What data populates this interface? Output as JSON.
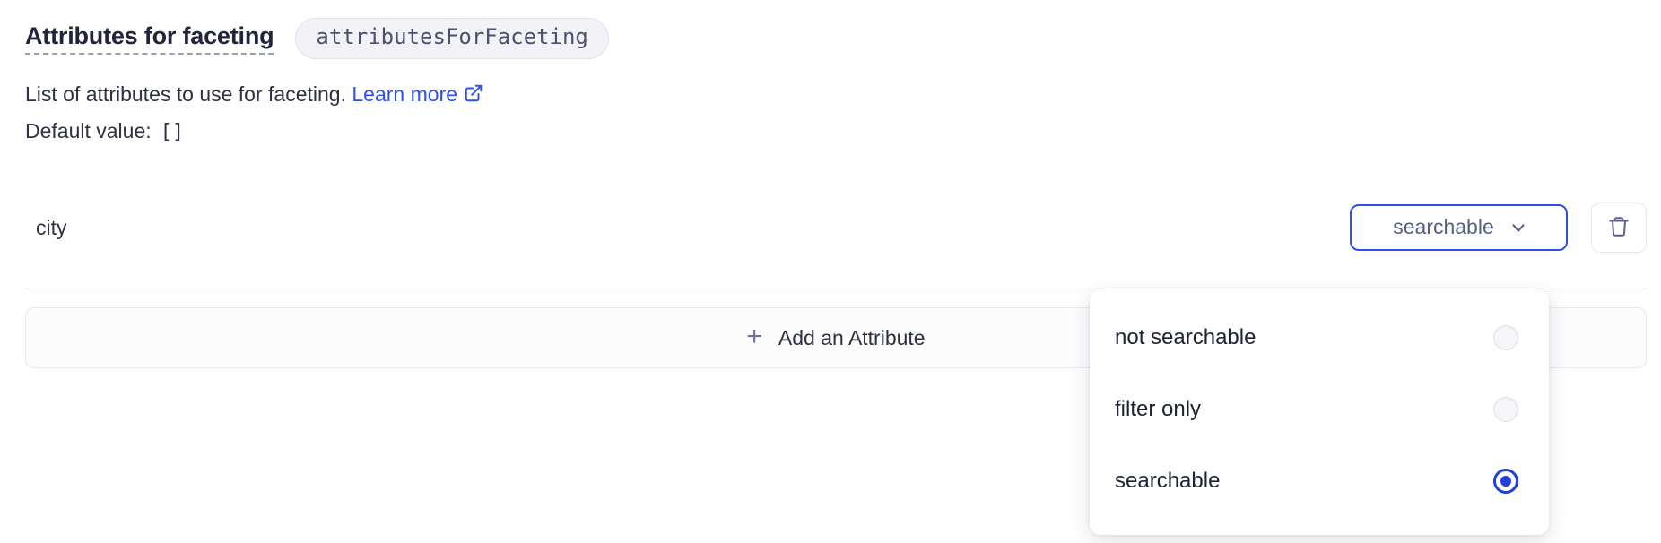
{
  "setting": {
    "title": "Attributes for faceting",
    "badge": "attributesForFaceting",
    "description_text": "List of attributes to use for faceting.",
    "learn_more_label": "Learn more",
    "default_value_label": "Default value:",
    "default_value": "[]"
  },
  "attribute_row": {
    "name": "city",
    "dropdown_value": "searchable"
  },
  "add_attribute": {
    "plus": "+",
    "label": "Add an Attribute"
  },
  "dropdown_menu": {
    "options": [
      {
        "label": "not searchable",
        "selected": false
      },
      {
        "label": "filter only",
        "selected": false
      },
      {
        "label": "searchable",
        "selected": true
      }
    ]
  },
  "colors": {
    "accent_blue": "#2c50f0",
    "radio_selected": "#2240dc",
    "text_primary": "#2d3142",
    "text_muted": "#565e85",
    "badge_bg": "#f2f2f7",
    "border_light": "#e8e8ee"
  }
}
